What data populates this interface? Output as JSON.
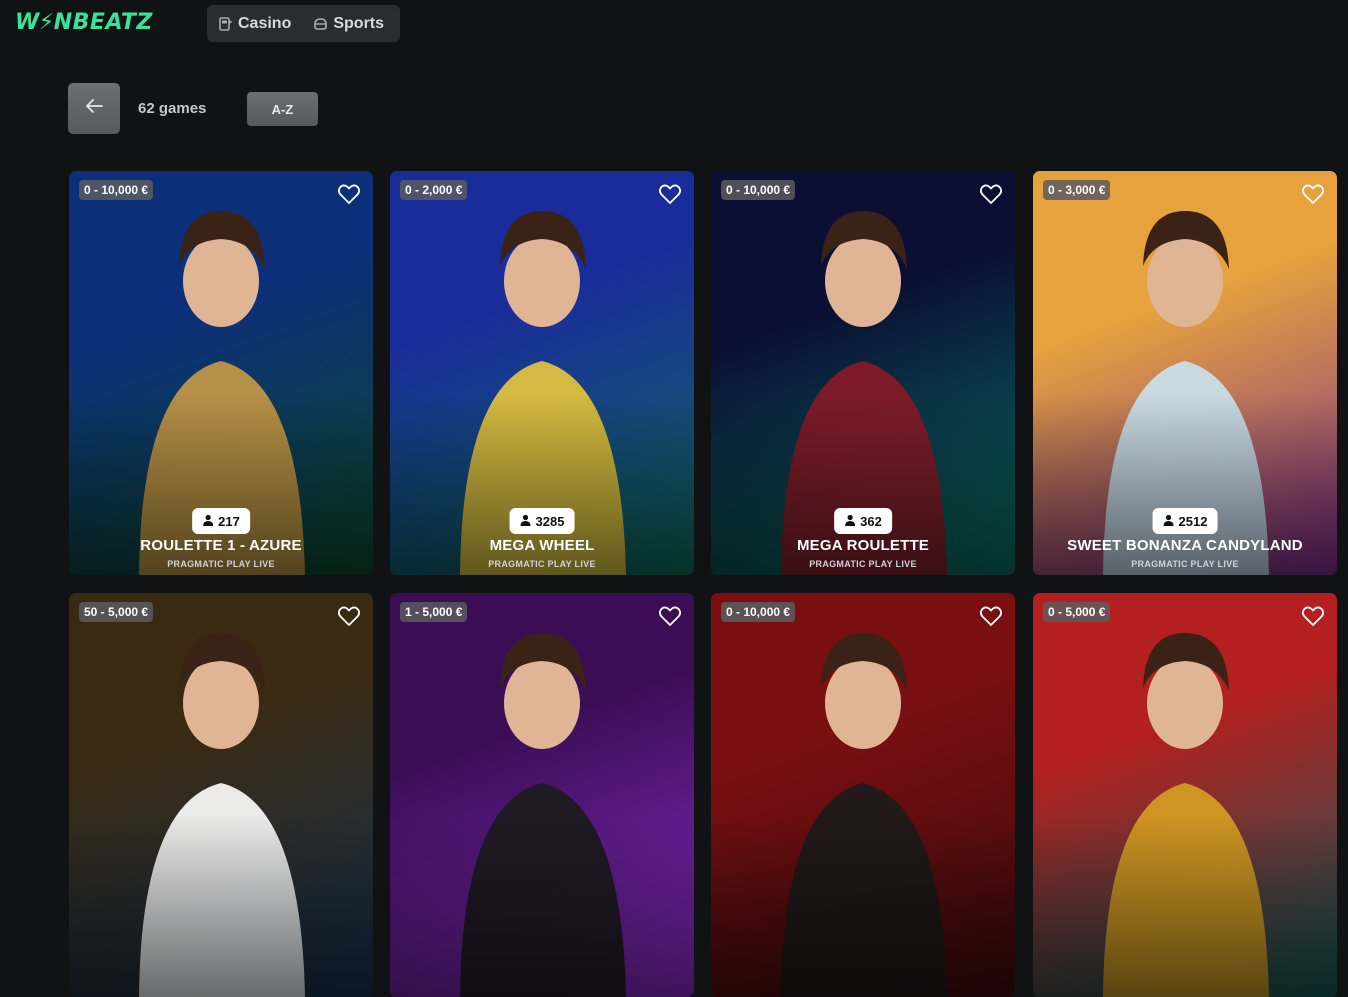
{
  "brand": {
    "logo_text_left": "W",
    "logo_text_right": "NBEATZ",
    "logo_bolt": "⚡"
  },
  "nav": {
    "items": [
      {
        "label": "Casino",
        "icon": "casino-icon"
      },
      {
        "label": "Sports",
        "icon": "sports-icon"
      }
    ]
  },
  "controls": {
    "back_icon": "arrow-left-icon",
    "games_count": "62 games",
    "sort_label": "A-Z"
  },
  "games": [
    {
      "limit": "0 - 10,000 €",
      "players": "217",
      "title": "ROULETTE 1 - AZURE",
      "provider": "PRAGMATIC PLAY LIVE",
      "bg_from": "#0c2f7a",
      "bg_to": "#0c4a2c",
      "accent": "#c99a44"
    },
    {
      "limit": "0 - 2,000 €",
      "players": "3285",
      "title": "MEGA WHEEL",
      "provider": "PRAGMATIC PLAY LIVE",
      "bg_from": "#1a2c9a",
      "bg_to": "#0d6d5a",
      "accent": "#e9c83a"
    },
    {
      "limit": "0 - 10,000 €",
      "players": "362",
      "title": "MEGA ROULETTE",
      "provider": "PRAGMATIC PLAY LIVE",
      "bg_from": "#0a0f33",
      "bg_to": "#0a6f63",
      "accent": "#8a1a27"
    },
    {
      "limit": "0 - 3,000 €",
      "players": "2512",
      "title": "SWEET BONANZA CANDYLAND",
      "provider": "PRAGMATIC PLAY LIVE",
      "bg_from": "#e6a23d",
      "bg_to": "#7a2b8f",
      "accent": "#c8e4f2"
    },
    {
      "limit": "50 - 5,000 €",
      "players": "",
      "title": "",
      "provider": "",
      "bg_from": "#3a2a12",
      "bg_to": "#143050",
      "accent": "#ffffff"
    },
    {
      "limit": "1 - 5,000 €",
      "players": "",
      "title": "",
      "provider": "",
      "bg_from": "#3a0d55",
      "bg_to": "#8a2cc9",
      "accent": "#1b1b1b"
    },
    {
      "limit": "0 - 10,000 €",
      "players": "",
      "title": "",
      "provider": "",
      "bg_from": "#7a0f12",
      "bg_to": "#3b0a0a",
      "accent": "#1b1b1b"
    },
    {
      "limit": "0 - 5,000 €",
      "players": "",
      "title": "",
      "provider": "",
      "bg_from": "#b41f1f",
      "bg_to": "#0f5a58",
      "accent": "#d7a021"
    }
  ]
}
